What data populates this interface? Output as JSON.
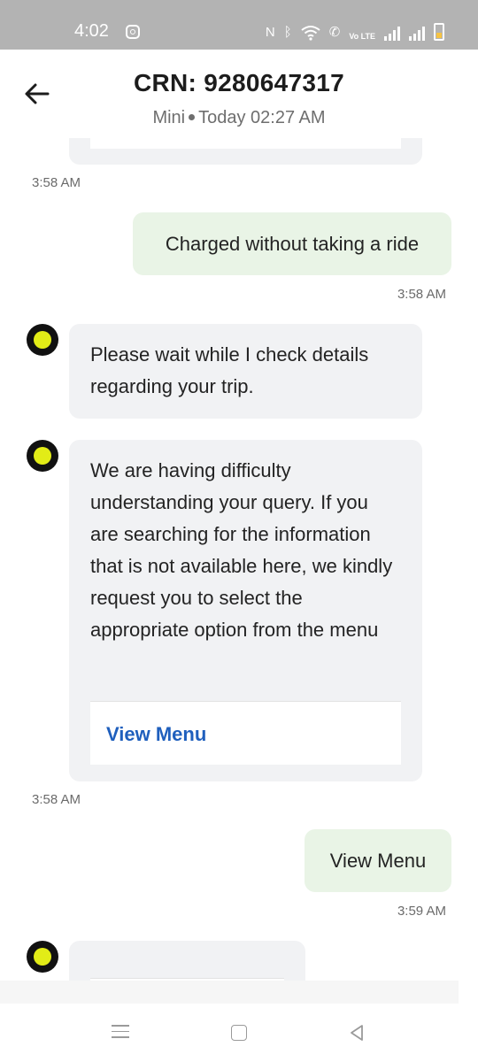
{
  "status": {
    "time": "4:02",
    "icons": [
      "instagram-icon",
      "nfc-icon",
      "bluetooth-icon",
      "wifi-icon",
      "wifi-calling-icon",
      "volte-icon",
      "signal-icon",
      "signal-icon",
      "battery-icon"
    ],
    "volte_label": "Vo LTE"
  },
  "header": {
    "title": "CRN: 9280647317",
    "ride_type": "Mini",
    "ride_time": "Today 02:27 AM"
  },
  "messages": {
    "ts_top": "3:58 AM",
    "user1": {
      "text": "Charged without taking a ride",
      "time": "3:58 AM"
    },
    "bot1": {
      "text": "Please wait while I check details regarding your trip."
    },
    "bot2": {
      "text": "We are having difficulty understanding your query. If you are searching for the information that is not available here, we kindly request you to select the appropriate option from the menu",
      "button": "View Menu",
      "time": "3:58 AM"
    },
    "user2": {
      "text": "View Menu",
      "time": "3:59 AM"
    }
  },
  "colors": {
    "status_bar": "#b3b3b3",
    "bot_bubble": "#f1f2f4",
    "user_bubble": "#e9f4e6",
    "link": "#1f5fbd",
    "avatar_accent": "#e2ec17"
  }
}
